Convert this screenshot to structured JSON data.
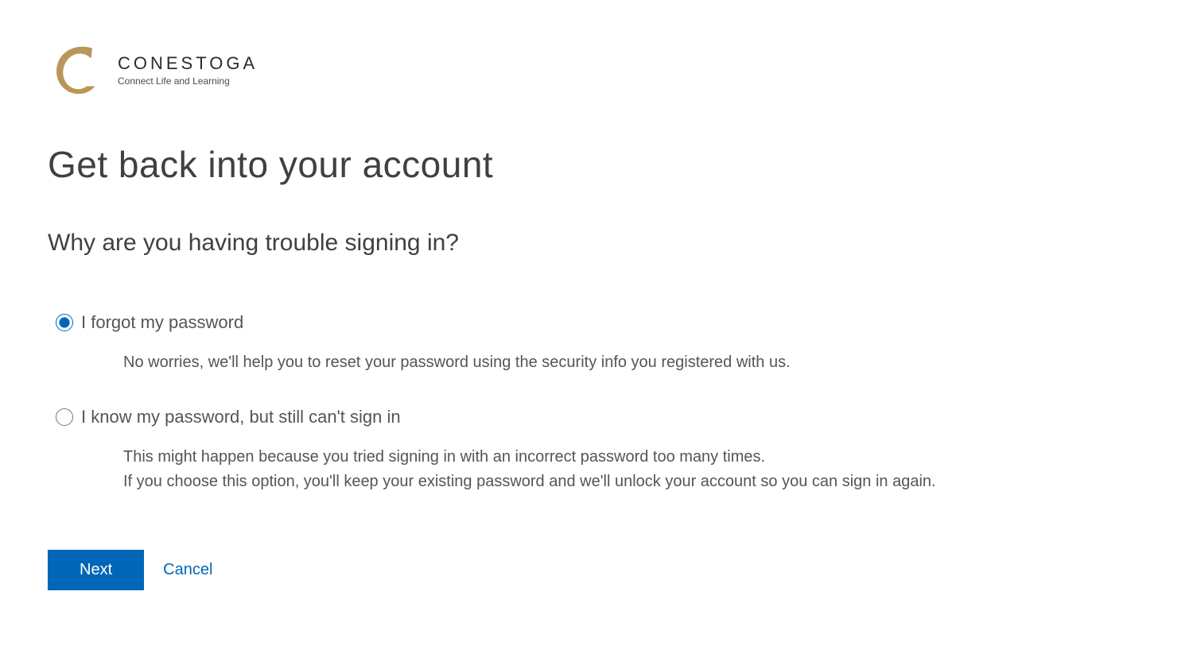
{
  "logo": {
    "name": "CONESTOGA",
    "tagline": "Connect Life and Learning"
  },
  "page_title": "Get back into your account",
  "subtitle": "Why are you having trouble signing in?",
  "options": [
    {
      "id": "forgot",
      "label": "I forgot my password",
      "description": "No worries, we'll help you to reset your password using the security info you registered with us.",
      "selected": true
    },
    {
      "id": "locked",
      "label": "I know my password, but still can't sign in",
      "description": "This might happen because you tried signing in with an incorrect password too many times.\nIf you choose this option, you'll keep your existing password and we'll unlock your account so you can sign in again.",
      "selected": false
    }
  ],
  "actions": {
    "next": "Next",
    "cancel": "Cancel"
  }
}
